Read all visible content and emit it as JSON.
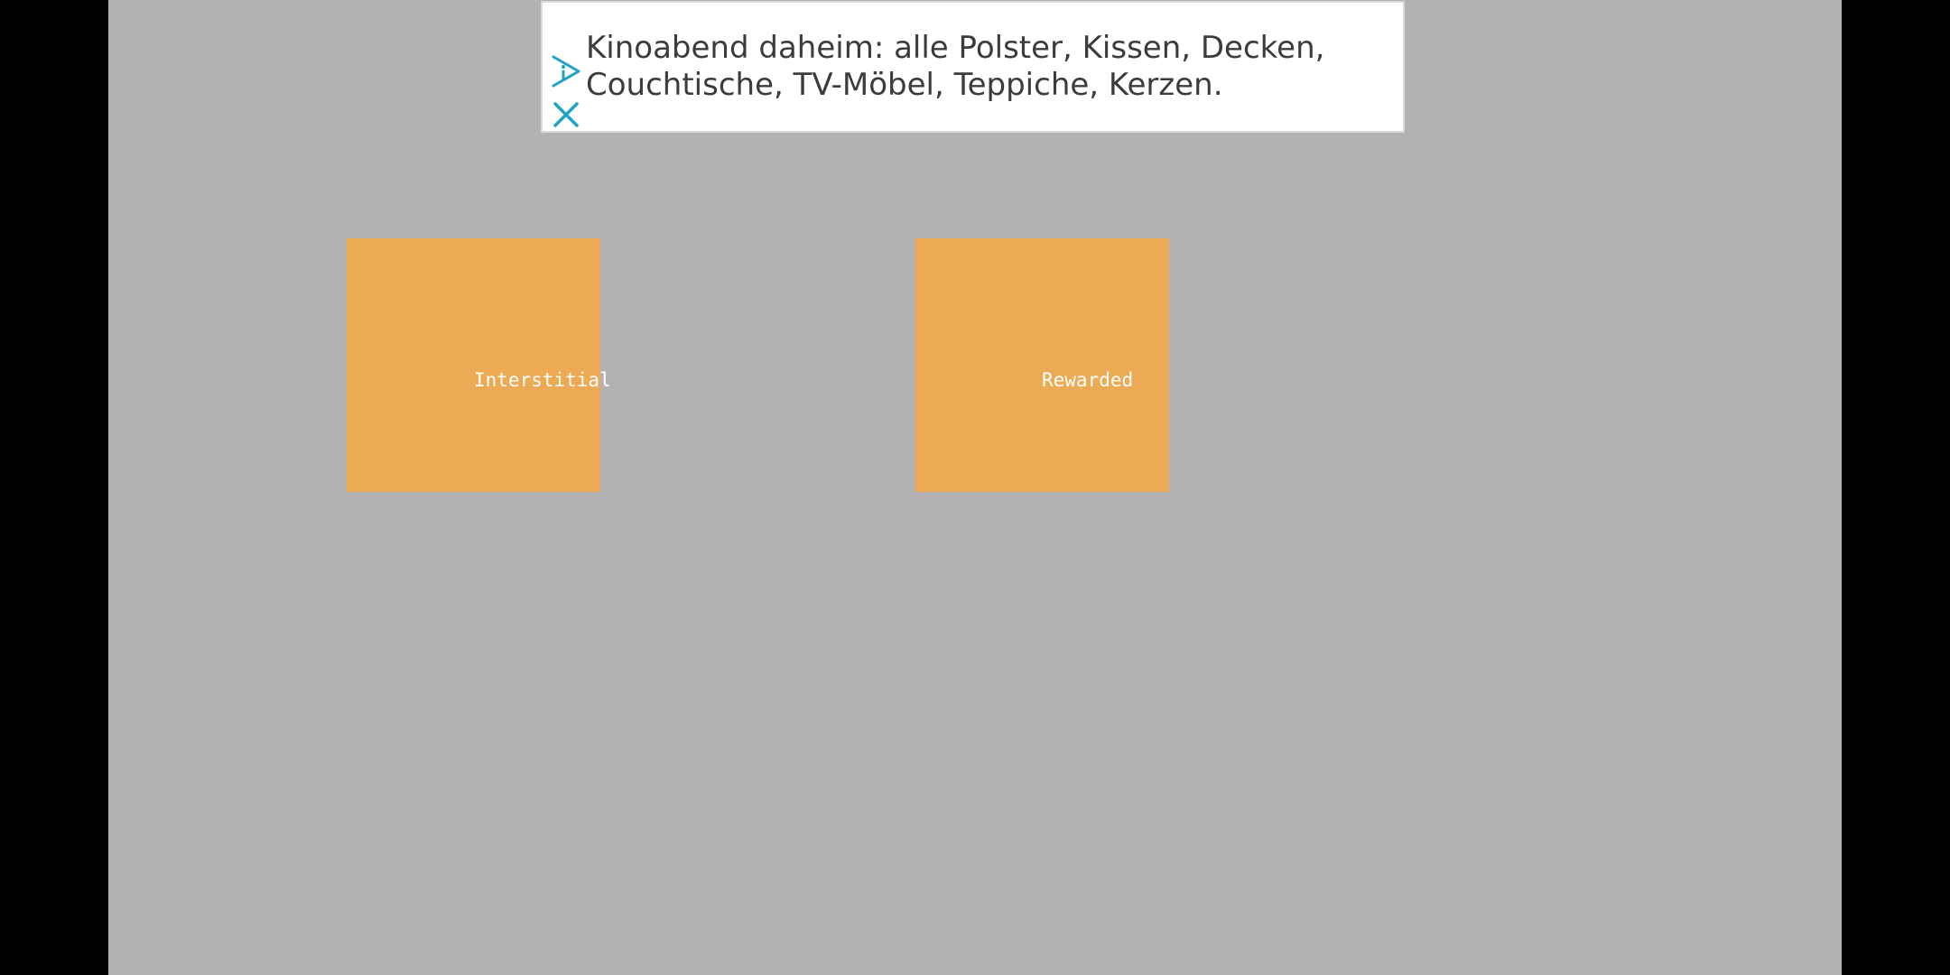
{
  "ad": {
    "line1": "Kinoabend daheim: alle Polster, Kissen, Decken,",
    "line2": "Couchtische, TV-Möbel, Teppiche, Kerzen.",
    "info_icon": "adchoices-icon",
    "close_icon": "close-icon",
    "accent_color": "#1fa3c5"
  },
  "buttons": [
    {
      "label": "Interstitial"
    },
    {
      "label": "Rewarded"
    }
  ],
  "colors": {
    "background": "#b3b1b4",
    "letterbox": "#000000",
    "tile": "#ecaa54",
    "tile_text": "#ffffff"
  }
}
